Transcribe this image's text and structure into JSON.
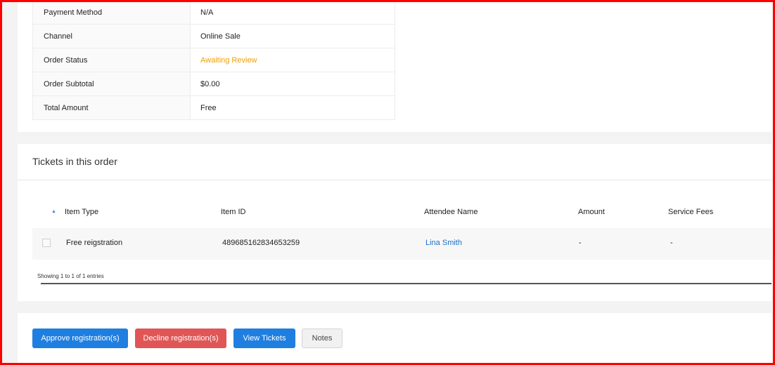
{
  "order_details": {
    "rows": [
      {
        "label": "Payment Method",
        "value": "N/A"
      },
      {
        "label": "Channel",
        "value": "Online Sale"
      },
      {
        "label": "Order Status",
        "value": "Awaiting Review"
      },
      {
        "label": "Order Subtotal",
        "value": "$0.00"
      },
      {
        "label": "Total Amount",
        "value": "Free"
      }
    ],
    "status_color": "#f0a000"
  },
  "tickets": {
    "title": "Tickets in this order",
    "columns": {
      "item_type": "Item Type",
      "item_id": "Item ID",
      "attendee_name": "Attendee Name",
      "amount": "Amount",
      "service_fees": "Service Fees"
    },
    "sort_indicator": "▲",
    "rows": [
      {
        "item_type": "Free reigstration",
        "item_id": "489685162834653259",
        "attendee_name": "Lina Smith",
        "amount": "-",
        "service_fees": "-"
      }
    ],
    "showing_text": "Showing 1 to 1 of 1 entries"
  },
  "actions": {
    "approve_label": "Approve registration(s)",
    "decline_label": "Decline registration(s)",
    "view_tickets_label": "View Tickets",
    "notes_label": "Notes",
    "colors": {
      "primary": "#1f7fe0",
      "danger": "#e05656",
      "default": "#f1f1f1"
    }
  }
}
